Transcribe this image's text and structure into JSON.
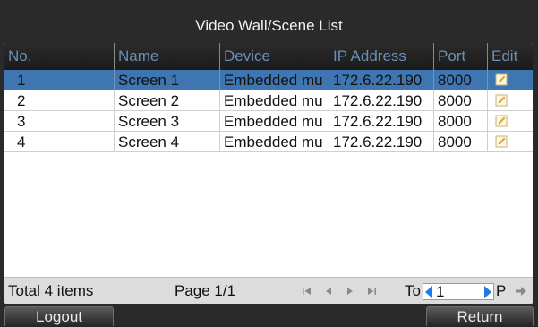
{
  "title": "Video Wall/Scene List",
  "columns": {
    "no": "No.",
    "name": "Name",
    "device": "Device",
    "ip": "IP Address",
    "port": "Port",
    "edit": "Edit"
  },
  "rows": [
    {
      "no": "1",
      "name": "Screen 1",
      "device": "Embedded mu",
      "ip": "172.6.22.190",
      "port": "8000",
      "selected": true
    },
    {
      "no": "2",
      "name": "Screen 2",
      "device": "Embedded mu",
      "ip": "172.6.22.190",
      "port": "8000",
      "selected": false
    },
    {
      "no": "3",
      "name": "Screen 3",
      "device": "Embedded mu",
      "ip": "172.6.22.190",
      "port": "8000",
      "selected": false
    },
    {
      "no": "4",
      "name": "Screen 4",
      "device": "Embedded mu",
      "ip": "172.6.22.190",
      "port": "8000",
      "selected": false
    }
  ],
  "footer": {
    "total": "Total 4 items",
    "page": "Page 1/1",
    "to_label": "To",
    "page_input_value": "1",
    "p_label": "P"
  },
  "buttons": {
    "logout": "Logout",
    "return": "Return"
  },
  "colors": {
    "selected_row": "#3f76b2",
    "header_text": "#6b8fb8",
    "nav_arrow": "#1f7be0"
  },
  "icons": {
    "edit": "edit-pencil-icon",
    "first": "first-page-icon",
    "prev": "prev-page-icon",
    "next": "next-page-icon",
    "last": "last-page-icon",
    "go": "go-arrow-icon"
  }
}
